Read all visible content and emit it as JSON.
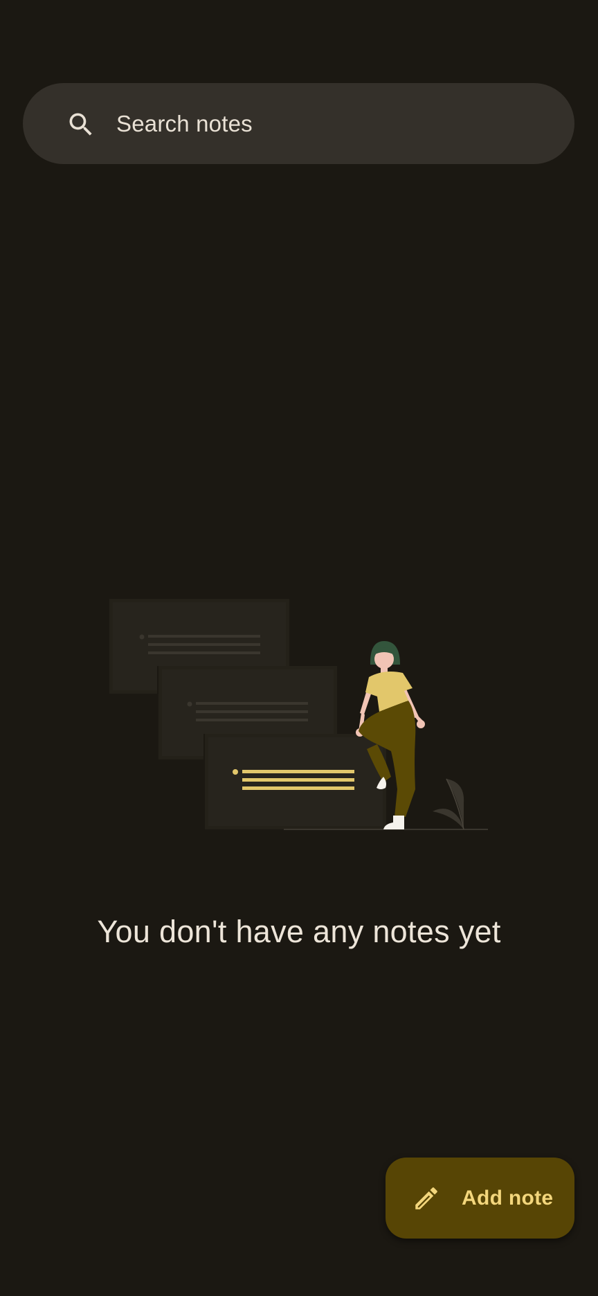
{
  "search": {
    "placeholder": "Search notes",
    "icon": "search-icon"
  },
  "empty_state": {
    "message": "You don't have any notes yet",
    "illustration": "empty-notes-illustration"
  },
  "fab": {
    "label": "Add note",
    "icon": "pencil-icon"
  },
  "colors": {
    "background": "#1b1812",
    "search_bar": "#34302a",
    "fab_background": "#574505",
    "fab_text": "#f3d67c",
    "accent_yellow": "#e2c76b"
  }
}
